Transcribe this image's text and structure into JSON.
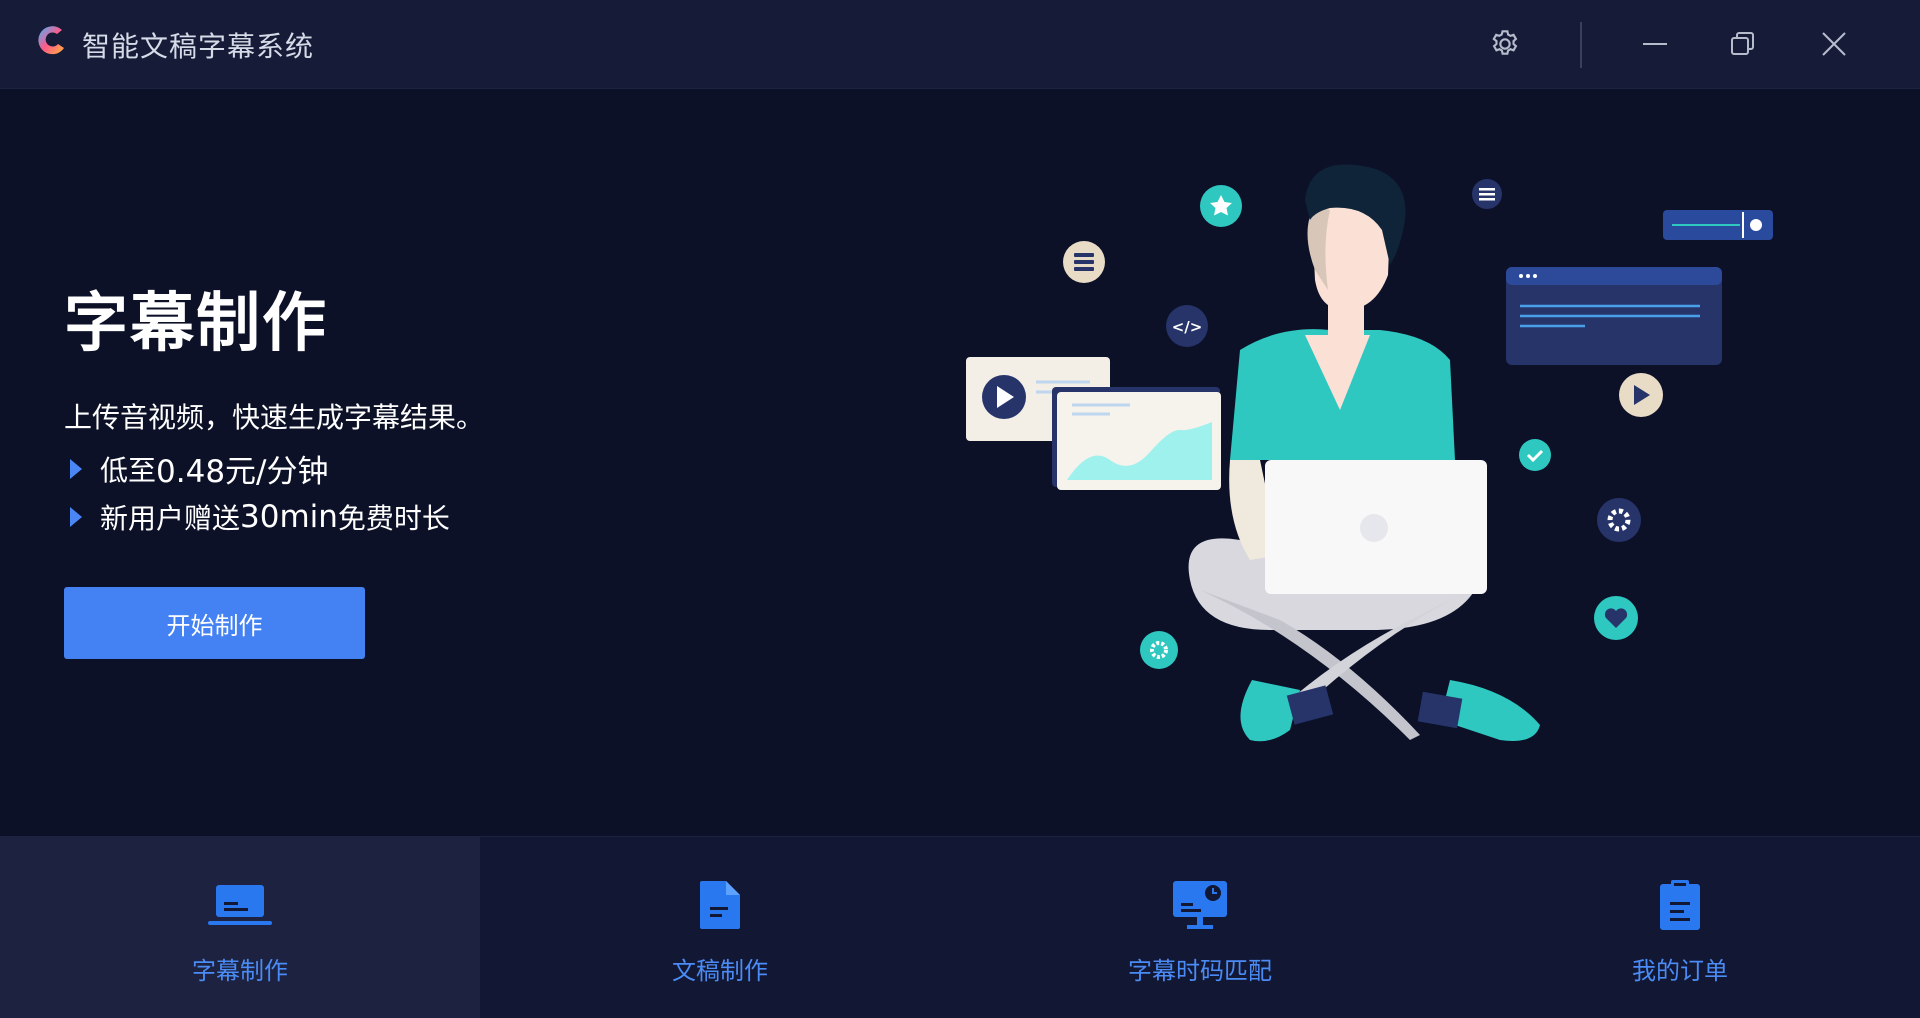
{
  "window": {
    "title": "智能文稿字幕系统",
    "controls": {
      "settings_icon": "gear-icon",
      "minimize_icon": "minimize-icon",
      "restore_icon": "restore-icon",
      "close_icon": "close-icon"
    }
  },
  "hero": {
    "title": "字幕制作",
    "subtitle": "上传音视频，快速生成字幕结果。",
    "features": [
      {
        "prefix": "低至",
        "highlight": "0.48元/分钟",
        "suffix": ""
      },
      {
        "prefix": "新用户赠送",
        "highlight": "30min",
        "suffix": "免费时长"
      }
    ],
    "start_button": "开始制作"
  },
  "nav": {
    "items": [
      {
        "label": "字幕制作",
        "icon": "subtitle-laptop-icon",
        "active": true
      },
      {
        "label": "文稿制作",
        "icon": "document-icon",
        "active": false
      },
      {
        "label": "字幕时码匹配",
        "icon": "monitor-clock-icon",
        "active": false
      },
      {
        "label": "我的订单",
        "icon": "clipboard-icon",
        "active": false
      }
    ]
  },
  "colors": {
    "background": "#0c1128",
    "titlebar": "#161b38",
    "accent": "#4481f2",
    "nav_label": "#4a8bf5",
    "teal": "#2ec8c0"
  }
}
